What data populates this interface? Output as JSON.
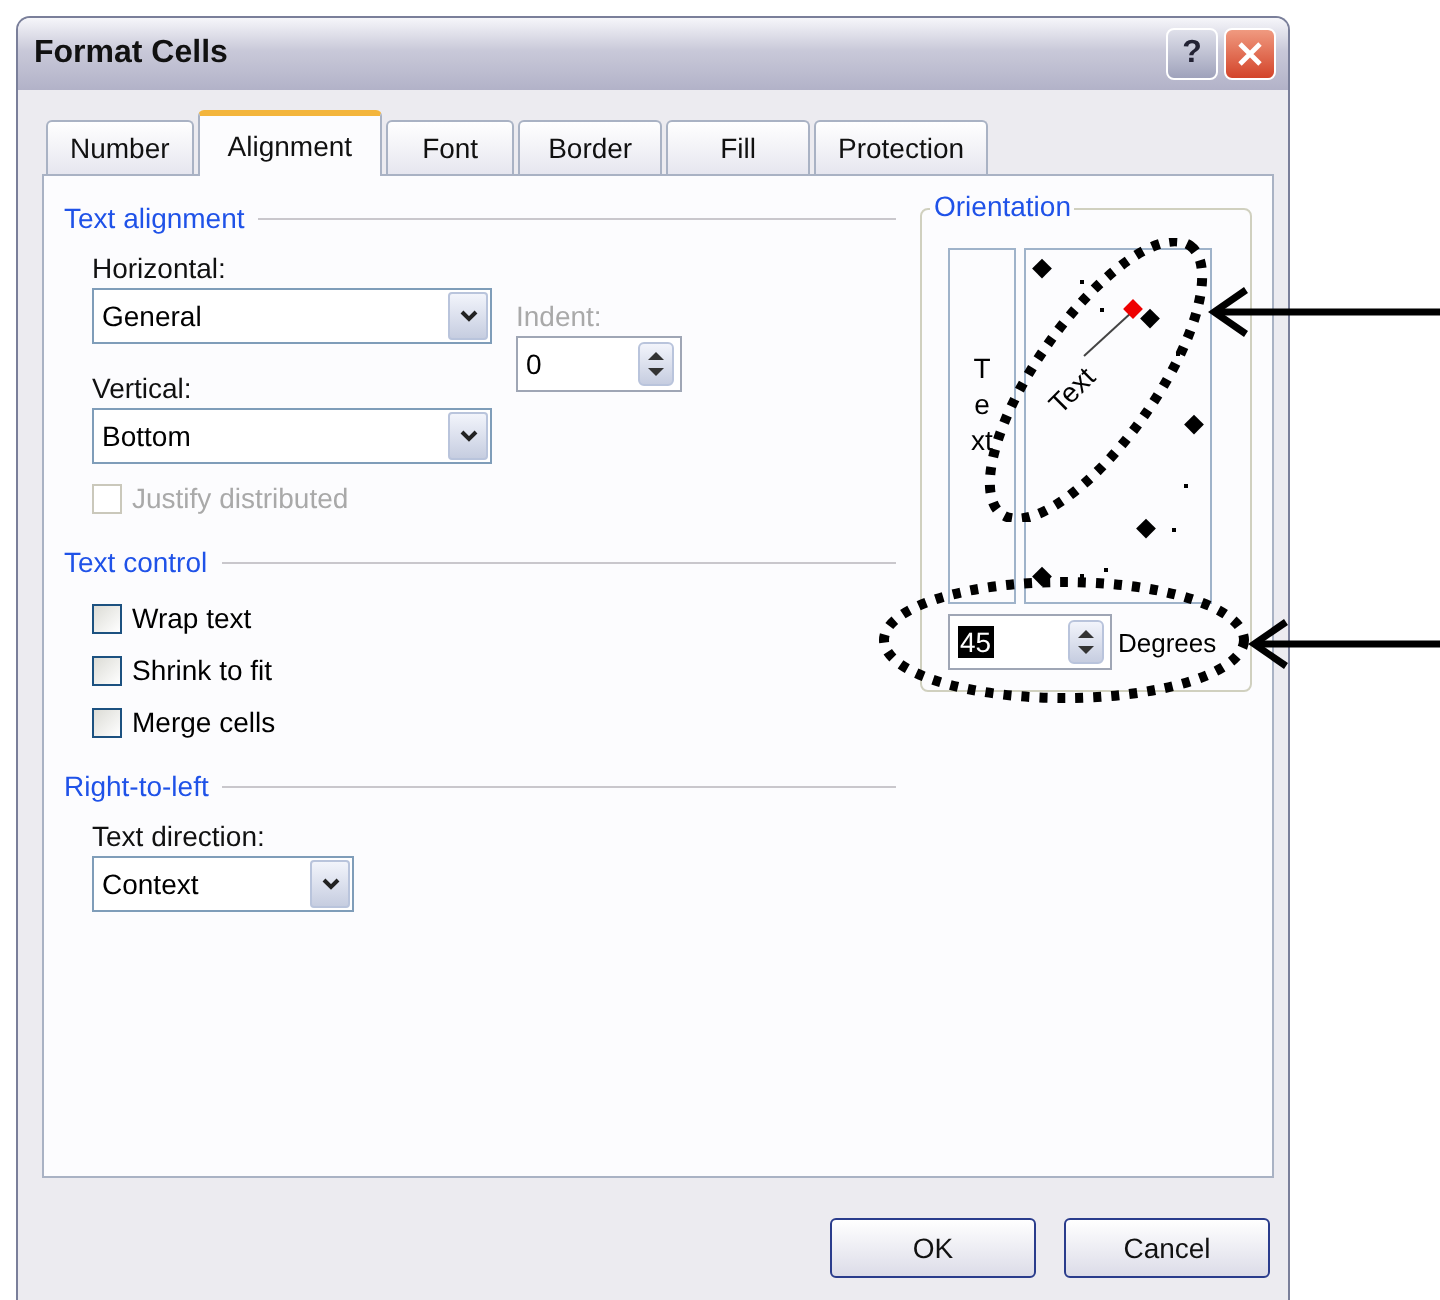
{
  "window": {
    "title": "Format Cells"
  },
  "title_buttons": [
    {
      "kind": "help",
      "label": "?"
    },
    {
      "kind": "close"
    }
  ],
  "tabs": [
    {
      "label": "Number",
      "selected": false
    },
    {
      "label": "Alignment",
      "selected": true
    },
    {
      "label": "Font",
      "selected": false
    },
    {
      "label": "Border",
      "selected": false
    },
    {
      "label": "Fill",
      "selected": false
    },
    {
      "label": "Protection",
      "selected": false
    }
  ],
  "text_alignment": {
    "title": "Text alignment",
    "horizontal_label": "Horizontal:",
    "horizontal_value": "General",
    "vertical_label": "Vertical:",
    "vertical_value": "Bottom",
    "indent_label": "Indent:",
    "indent_value": "0",
    "indent_disabled": true,
    "justify": {
      "label": "Justify distributed",
      "checked": false,
      "disabled": true
    }
  },
  "text_control": {
    "title": "Text control",
    "options": [
      {
        "label": "Wrap text",
        "checked": false
      },
      {
        "label": "Shrink to fit",
        "checked": false
      },
      {
        "label": "Merge cells",
        "checked": false
      }
    ]
  },
  "right_to_left": {
    "title": "Right-to-left",
    "direction_label": "Text direction:",
    "direction_value": "Context"
  },
  "orientation": {
    "title": "Orientation",
    "vertical_text": "Text",
    "dial_text": "Text",
    "degrees_value": "45",
    "degrees_label": "Degrees"
  },
  "buttons": [
    "OK",
    "Cancel"
  ]
}
